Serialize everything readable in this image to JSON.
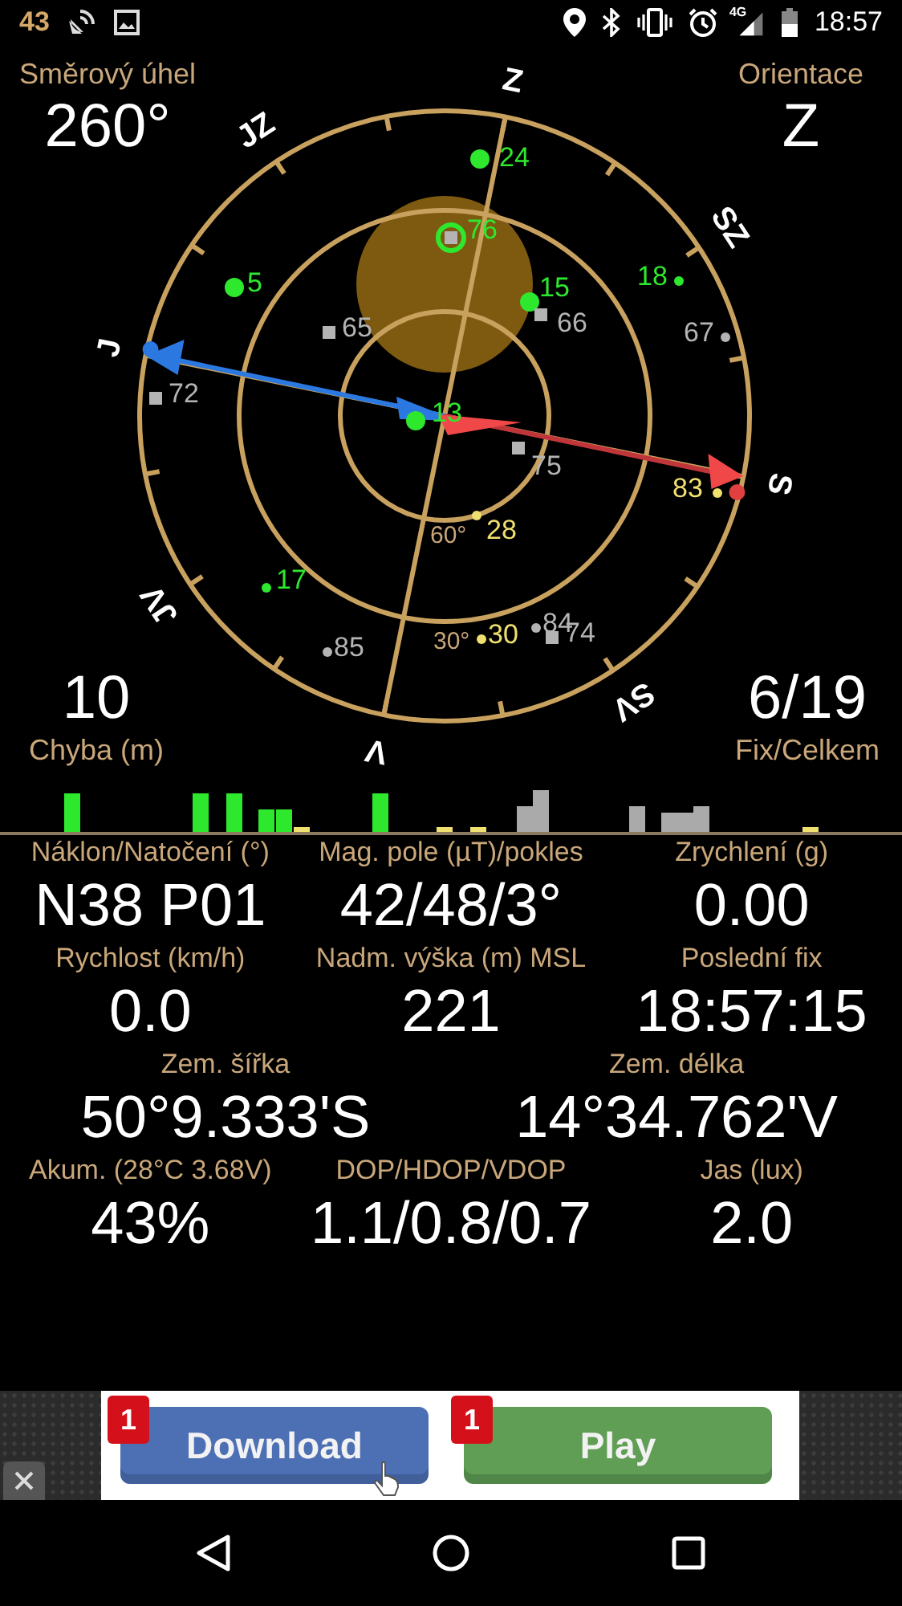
{
  "status_bar": {
    "notification_count": "43",
    "network_label": "4G",
    "time": "18:57"
  },
  "heading": {
    "label": "Směrový úhel",
    "value": "260°"
  },
  "orientation": {
    "label": "Orientace",
    "value": "Z"
  },
  "error": {
    "label": "Chyba (m)",
    "value": "10"
  },
  "fix": {
    "label": "Fix/Celkem",
    "value": "6/19"
  },
  "compass": {
    "labels": [
      "Z",
      "SZ",
      "S",
      "SV",
      "V",
      "JV",
      "J",
      "JZ"
    ],
    "ring_labels": [
      "60°",
      "30°"
    ]
  },
  "satellites": [
    {
      "label": "24",
      "kind": "dot",
      "color": "#2ee82e"
    },
    {
      "label": "76",
      "kind": "ring",
      "color": "#2ee82e"
    },
    {
      "label": "5",
      "kind": "dot",
      "color": "#2ee82e"
    },
    {
      "label": "15",
      "kind": "dot",
      "color": "#2ee82e"
    },
    {
      "label": "66",
      "kind": "square",
      "color": "#b4b4b4"
    },
    {
      "label": "18",
      "kind": "point",
      "color": "#2ee82e"
    },
    {
      "label": "65",
      "kind": "square",
      "color": "#b4b4b4"
    },
    {
      "label": "67",
      "kind": "point",
      "color": "#b4b4b4"
    },
    {
      "label": "72",
      "kind": "square",
      "color": "#b4b4b4"
    },
    {
      "label": "13",
      "kind": "dot",
      "color": "#2ee82e"
    },
    {
      "label": "75",
      "kind": "square",
      "color": "#b4b4b4"
    },
    {
      "label": "83",
      "kind": "point",
      "color": "#f0e070"
    },
    {
      "label": "28",
      "kind": "point",
      "color": "#f0e070"
    },
    {
      "label": "17",
      "kind": "point",
      "color": "#2ee82e"
    },
    {
      "label": "30",
      "kind": "point",
      "color": "#f0e070"
    },
    {
      "label": "84",
      "kind": "point",
      "color": "#b4b4b4"
    },
    {
      "label": "74",
      "kind": "square",
      "color": "#b4b4b4"
    },
    {
      "label": "85",
      "kind": "point",
      "color": "#b4b4b4"
    }
  ],
  "readings": [
    [
      {
        "label": "Náklon/Natočení (°)",
        "value": "N38 P01"
      },
      {
        "label": "Mag. pole (µT)/pokles",
        "value": "42/48/3°"
      },
      {
        "label": "Zrychlení (g)",
        "value": "0.00"
      }
    ],
    [
      {
        "label": "Rychlost (km/h)",
        "value": "0.0"
      },
      {
        "label": "Nadm. výška (m) MSL",
        "value": "221"
      },
      {
        "label": "Poslední fix",
        "value": "18:57:15"
      }
    ],
    [
      {
        "label": "Zem. šířka",
        "value": "50°9.333'S"
      },
      {
        "label": "Zem. délka",
        "value": "14°34.762'V"
      }
    ],
    [
      {
        "label": "Akum. (28°C 3.68V)",
        "value": "43%"
      },
      {
        "label": "DOP/HDOP/VDOP",
        "value": "1.1/0.8/0.7"
      },
      {
        "label": "Jas (lux)",
        "value": "2.0"
      }
    ]
  ],
  "ad": {
    "buttons": [
      {
        "label": "Download",
        "badge": "1",
        "color": "#4d70b5"
      },
      {
        "label": "Play",
        "badge": "1",
        "color": "#5f9e54"
      }
    ]
  }
}
